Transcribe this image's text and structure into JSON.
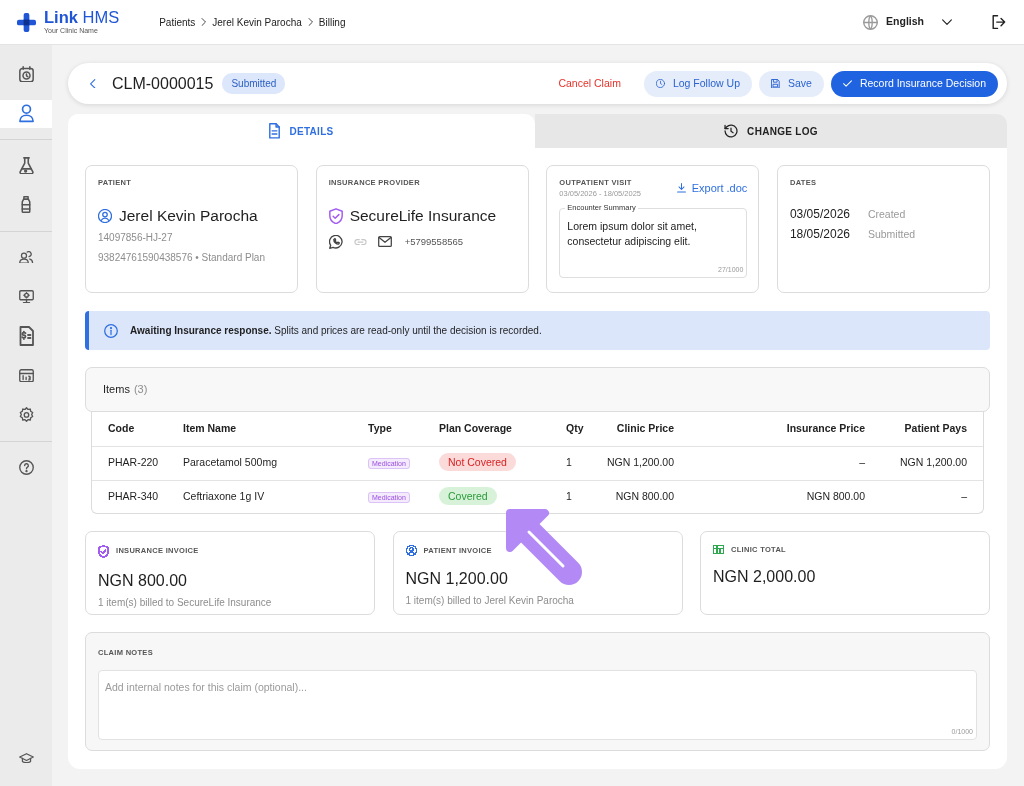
{
  "app": {
    "brand": "**Link** HMS",
    "tagline": "Your Clinic Name"
  },
  "breadcrumb": [
    {
      "label": "Patients"
    },
    {
      "label": "Jerel Kevin Parocha"
    },
    {
      "label": "Billing"
    }
  ],
  "language": {
    "label": "English"
  },
  "sidebar": {
    "groups": [
      {
        "items": [
          {
            "selected": false
          },
          {
            "selected": true
          }
        ]
      },
      {
        "items": [
          {
            "selected": false
          },
          {
            "selected": false
          }
        ]
      },
      {
        "items": [
          {
            "selected": false
          },
          {
            "selected": false
          },
          {
            "selected": false
          },
          {
            "selected": false
          },
          {
            "selected": false
          }
        ]
      },
      {
        "items": [
          {
            "selected": false
          }
        ]
      }
    ],
    "footer": {
      "items": [
        {
          "selected": false
        }
      ]
    }
  },
  "claim": {
    "number": "CLM-0000015",
    "status": "Submitted"
  },
  "actions": [
    {
      "label": "Cancel Claim",
      "kind": "danger"
    },
    {
      "label": "Log Follow Up",
      "kind": "soft"
    },
    {
      "label": "Save",
      "kind": "soft"
    },
    {
      "label": "Record Insurance Decision",
      "kind": "primary"
    }
  ],
  "tabs": [
    {
      "label": "DETAILS",
      "selected": true
    },
    {
      "label": "CHANGE LOG",
      "selected": false
    }
  ],
  "patient_card": {
    "heading": "PATIENT",
    "name": "Jerel Kevin Parocha",
    "id": "14097856-HJ-27",
    "details": "93824761590438576 • Standard Plan"
  },
  "provider_card": {
    "heading": "INSURANCE PROVIDER",
    "name": "SecureLife Insurance",
    "contacts": [
      {
        "disabled": false
      },
      {
        "disabled": true
      },
      {
        "disabled": false
      }
    ],
    "phone": "+5799558565"
  },
  "visit_card": {
    "heading": "OUTPATIENT VISIT",
    "period": "03/05/2026 - 18/05/2025",
    "export_label": "Export .doc",
    "summary": {
      "label": "Encounter Summary",
      "value": "Lorem ipsum dolor sit amet, consectetur adipiscing elit.",
      "counter": "27/1000"
    }
  },
  "dates_card": {
    "heading": "DATES",
    "entries": [
      {
        "date": "03/05/2026",
        "label": "Created"
      },
      {
        "date": "18/05/2026",
        "label": "Submitted"
      }
    ]
  },
  "alert": {
    "text": "**Awaiting Insurance response.** Splits and prices are read-only until the decision is recorded."
  },
  "items": {
    "title": "Items",
    "count": "(3)",
    "table": {
      "columns": [
        "Code",
        "Item Name",
        "Type",
        "Plan Coverage",
        "Qty",
        "Clinic Price",
        "Insurance Price",
        "Patient Pays"
      ],
      "rows": [
        {
          "code": "PHAR-220",
          "name": "Paracetamol 500mg",
          "type": "Medication",
          "coverage": {
            "label": "Not Covered",
            "covered": false
          },
          "qty": "1",
          "clinic_price": "NGN 1,200.00",
          "insurance_price": "–",
          "patient_pays": "NGN 1,200.00"
        },
        {
          "code": "PHAR-340",
          "name": "Ceftriaxone 1g IV",
          "type": "Medication",
          "coverage": {
            "label": "Covered",
            "covered": true
          },
          "qty": "1",
          "clinic_price": "NGN 800.00",
          "insurance_price": "NGN 800.00",
          "patient_pays": "–"
        }
      ]
    }
  },
  "summary_cards": [
    {
      "heading": "INSURANCE INVOICE",
      "color": "#a35cf0",
      "amount": "NGN 800.00",
      "note": "1 item(s) billed to SecureLife Insurance"
    },
    {
      "heading": "PATIENT INVOICE",
      "color": "#2f6fe0",
      "amount": "NGN 1,200.00",
      "note": "1 item(s) billed to Jerel Kevin Parocha"
    },
    {
      "heading": "CLINIC TOTAL",
      "color": "#2fa84f",
      "amount": "NGN 2,000.00"
    }
  ],
  "notes": {
    "heading": "CLAIM NOTES",
    "placeholder": "Add internal notes for this claim (optional)...",
    "counter": "0/1000"
  }
}
